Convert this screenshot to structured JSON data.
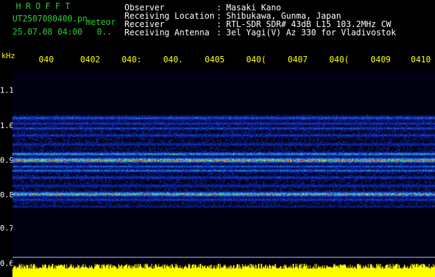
{
  "header": {
    "title": "HROFFT",
    "file_name": "UT2507080400.pn",
    "meteor_label": "meteor",
    "datetime": "25.07.08 04:00",
    "count": "0..",
    "info": [
      {
        "label": "Observer",
        "value": "Masaki Kano"
      },
      {
        "label": "Receiving Location",
        "value": "Shibukawa, Gunma, Japan"
      },
      {
        "label": "Receiver",
        "value": "RTL-SDR SDR# 43dB L15 103.2MHz CW"
      },
      {
        "label": "Receiving Antenna",
        "value": "3el Yagi(V) Az 330 for Vladivostok"
      }
    ]
  },
  "axis": {
    "unit": "kHz",
    "x_ticks": [
      "040",
      "0402",
      "040:",
      "040.",
      "0405",
      "040(",
      "0407",
      "040(",
      "0409",
      "0410"
    ],
    "y_ticks": [
      "1.1",
      "1.0",
      "0.9",
      "0.8",
      "0.7",
      "0.6"
    ]
  },
  "colors": {
    "header_green": "#2fd02f",
    "tick_yellow": "#ffff00",
    "text_white": "#ffffff",
    "plot_background": "#000010",
    "power_trace": "#ffff00"
  }
}
